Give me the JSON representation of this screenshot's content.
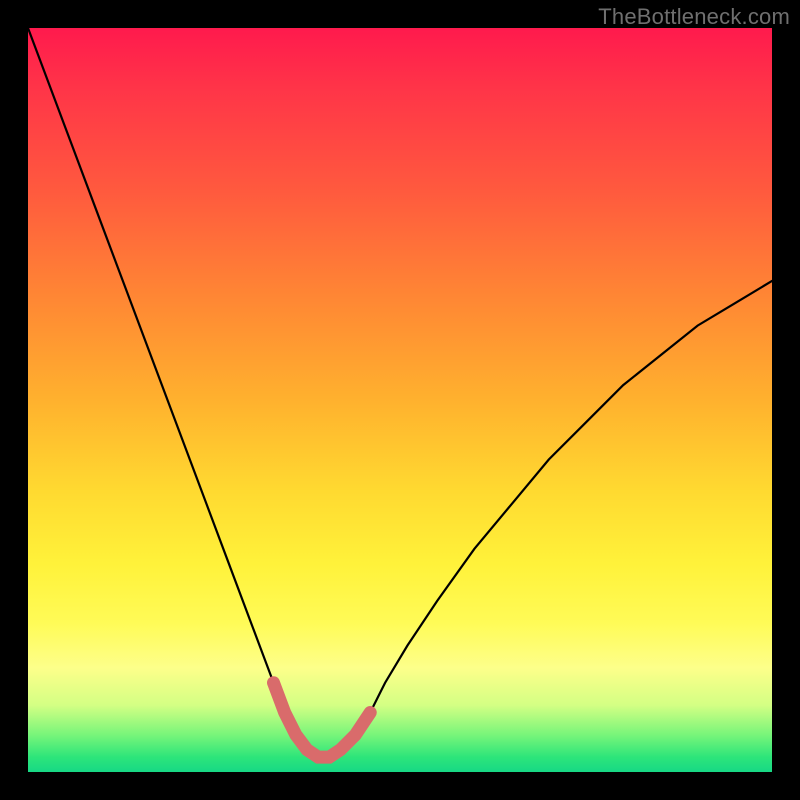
{
  "watermark": "TheBottleneck.com",
  "colors": {
    "frame": "#000000",
    "curve_stroke": "#000000",
    "highlight_stroke": "#d96b6b",
    "gradient_stops": [
      "#ff1a4d",
      "#ff5a3e",
      "#ffb12e",
      "#fff23a",
      "#78f57a",
      "#17d885"
    ]
  },
  "chart_data": {
    "type": "line",
    "title": "",
    "xlabel": "",
    "ylabel": "",
    "xlim": [
      0,
      100
    ],
    "ylim": [
      0,
      100
    ],
    "x": [
      0,
      3,
      6,
      9,
      12,
      15,
      18,
      21,
      24,
      27,
      30,
      33,
      34.5,
      36,
      37.5,
      39,
      40.5,
      42,
      44,
      46,
      48,
      51,
      55,
      60,
      65,
      70,
      75,
      80,
      85,
      90,
      95,
      100
    ],
    "values": [
      100,
      92,
      84,
      76,
      68,
      60,
      52,
      44,
      36,
      28,
      20,
      12,
      8,
      5,
      3,
      2,
      2,
      3,
      5,
      8,
      12,
      17,
      23,
      30,
      36,
      42,
      47,
      52,
      56,
      60,
      63,
      66
    ],
    "highlight_range_x": [
      31,
      47
    ],
    "annotations": []
  }
}
